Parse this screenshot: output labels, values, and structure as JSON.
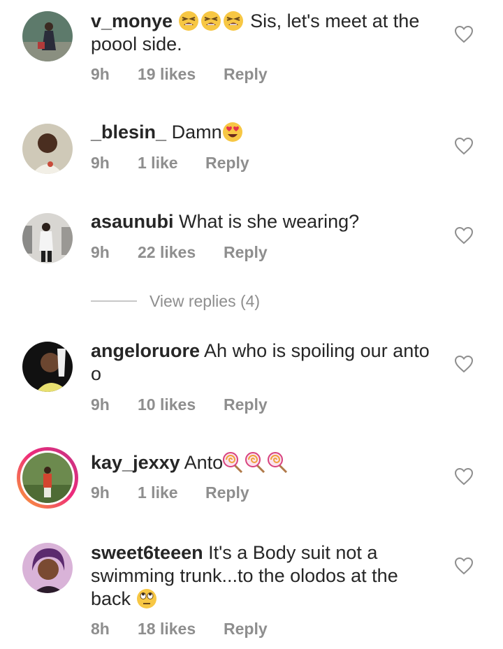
{
  "comments": [
    {
      "username": "v_monye",
      "emoji_after_name": [
        "tired-face-emoji",
        "tired-face-emoji",
        "tired-face-emoji"
      ],
      "text": " Sis, let's meet at the poool side.",
      "time": "9h",
      "likes": "19 likes",
      "reply": "Reply"
    },
    {
      "username": "_blesin_",
      "text": " Damn",
      "emoji_after_text": [
        "heart-eyes-emoji"
      ],
      "time": "9h",
      "likes": "1 like",
      "reply": "Reply"
    },
    {
      "username": "asaunubi",
      "text": " What is she wearing?",
      "time": "9h",
      "likes": "22 likes",
      "reply": "Reply"
    },
    {
      "username": "angeloruore",
      "text": " Ah who is spoiling our anto o",
      "time": "9h",
      "likes": "10 likes",
      "reply": "Reply"
    },
    {
      "username": "kay_jexxy",
      "text": " Anto",
      "emoji_after_text": [
        "lollipop-emoji",
        "lollipop-emoji",
        "lollipop-emoji"
      ],
      "has_story_ring": true,
      "time": "9h",
      "likes": "1 like",
      "reply": "Reply"
    },
    {
      "username": "sweet6teeen",
      "text": " It's a Body suit not a swimming trunk...to the olodos at the back ",
      "emoji_after_text": [
        "eye-roll-emoji"
      ],
      "time": "8h",
      "likes": "18 likes",
      "reply": "Reply"
    }
  ],
  "view_replies": "View replies (4)",
  "colors": {
    "text": "#262626",
    "meta": "#8e8e8e",
    "divider": "#c7c7c7",
    "story_ring_start": "#f9a434",
    "story_ring_end": "#c13584"
  },
  "icons": {
    "like": "heart-outline-icon"
  }
}
